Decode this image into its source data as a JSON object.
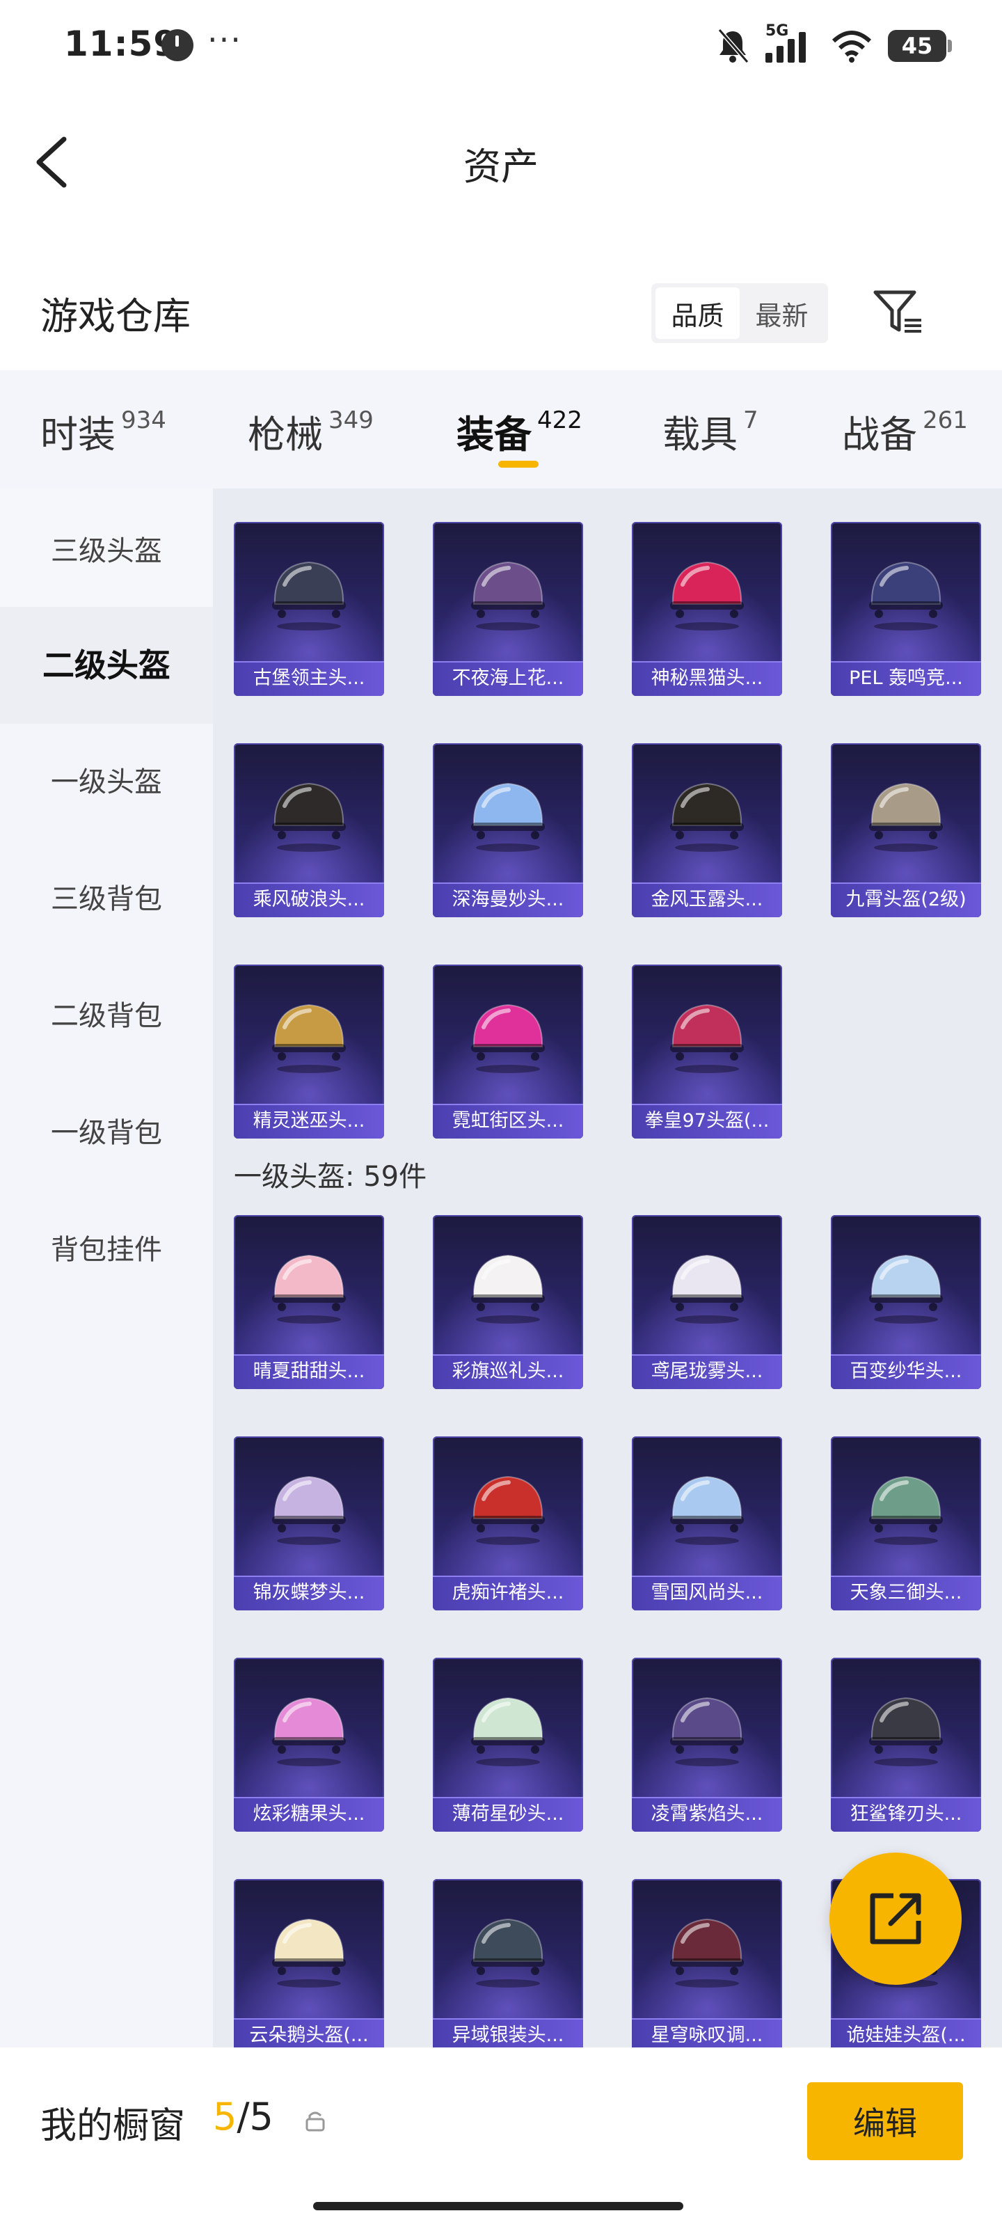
{
  "status_bar": {
    "time": "11:59",
    "more": "···",
    "network": "5G",
    "battery": "45"
  },
  "header": {
    "title": "资产"
  },
  "warehouse": {
    "title": "游戏仓库",
    "sort_options": [
      "品质",
      "最新"
    ],
    "active_sort": "品质"
  },
  "tabs": [
    {
      "label": "时装",
      "count": "934"
    },
    {
      "label": "枪械",
      "count": "349"
    },
    {
      "label": "装备",
      "count": "422"
    },
    {
      "label": "载具",
      "count": "7"
    },
    {
      "label": "战备",
      "count": "261"
    }
  ],
  "active_tab": "装备",
  "sidebar": {
    "items": [
      "三级头盔",
      "二级头盔",
      "一级头盔",
      "三级背包",
      "二级背包",
      "一级背包",
      "背包挂件"
    ],
    "active": "二级头盔"
  },
  "level2_items": [
    {
      "name": "古堡领主头...",
      "color": "#3a3f55"
    },
    {
      "name": "不夜海上花...",
      "color": "#6b4e8a"
    },
    {
      "name": "神秘黑猫头...",
      "color": "#d9245a"
    },
    {
      "name": "PEL 轰鸣竞...",
      "color": "#3b3f7a"
    },
    {
      "name": "乘风破浪头...",
      "color": "#2e2a2a"
    },
    {
      "name": "深海曼妙头...",
      "color": "#8fb7ef"
    },
    {
      "name": "金风玉露头...",
      "color": "#2d2a26"
    },
    {
      "name": "九霄头盔(2级)",
      "color": "#a89b88"
    },
    {
      "name": "精灵迷巫头...",
      "color": "#c79a44"
    },
    {
      "name": "霓虹街区头...",
      "color": "#e0309a"
    },
    {
      "name": "拳皇97头盔(...",
      "color": "#c0305a"
    }
  ],
  "level1_section": {
    "label": "一级头盔: 59件"
  },
  "level1_items": [
    {
      "name": "晴夏甜甜头...",
      "color": "#f4b9c9"
    },
    {
      "name": "彩旗巡礼头...",
      "color": "#f4f2f2"
    },
    {
      "name": "鸢尾珑雾头...",
      "color": "#e9e6f2"
    },
    {
      "name": "百变纱华头...",
      "color": "#b8d3f0"
    },
    {
      "name": "锦灰蝶梦头...",
      "color": "#c7b3e2"
    },
    {
      "name": "虎痴许褚头...",
      "color": "#c9302c"
    },
    {
      "name": "雪国风尚头...",
      "color": "#a9c9f0"
    },
    {
      "name": "天象三御头...",
      "color": "#6e9e8a"
    },
    {
      "name": "炫彩糖果头...",
      "color": "#e48ad6"
    },
    {
      "name": "薄荷星砂头...",
      "color": "#cfe6d3"
    },
    {
      "name": "凌霄紫焰头...",
      "color": "#5a4a8a"
    },
    {
      "name": "狂鲨锋刃头...",
      "color": "#3a3a44"
    },
    {
      "name": "云朵鹅头盔(...",
      "color": "#f3e6c3"
    },
    {
      "name": "异域银装头...",
      "color": "#3d4b5a"
    },
    {
      "name": "星穹咏叹调...",
      "color": "#6a2a3a"
    },
    {
      "name": "诡娃娃头盔(...",
      "color": "#d9a25a"
    }
  ],
  "bottom_bar": {
    "label": "我的橱窗",
    "current": "5",
    "total": "/5",
    "edit_label": "编辑"
  },
  "colors": {
    "accent": "#f7b500",
    "card_name_bg": "#5a4bc6",
    "panel_bg": "#f3f5fa"
  }
}
